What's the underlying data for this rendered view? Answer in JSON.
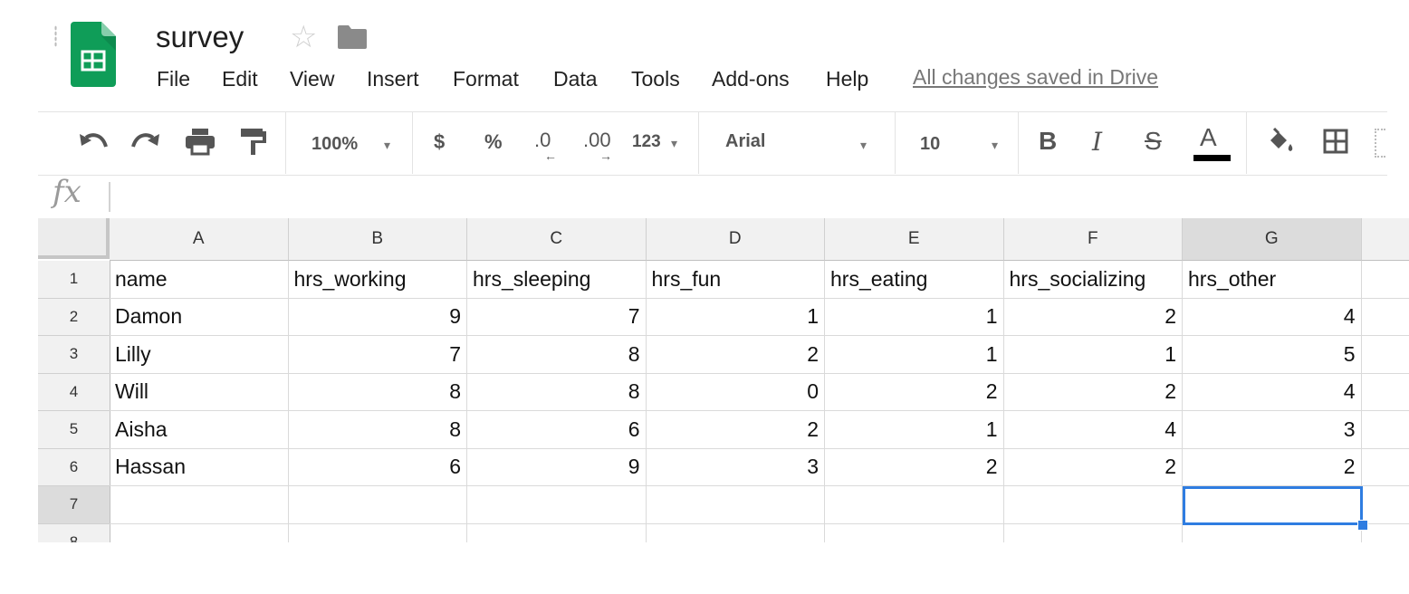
{
  "document": {
    "title": "survey"
  },
  "menu": {
    "items": [
      "File",
      "Edit",
      "View",
      "Insert",
      "Format",
      "Data",
      "Tools",
      "Add-ons",
      "Help"
    ],
    "save_status": "All changes saved in Drive"
  },
  "toolbar": {
    "zoom": "100%",
    "currency": "$",
    "percent": "%",
    "decrease_decimal": ".0",
    "increase_decimal": ".00",
    "more_formats": "123",
    "font": "Arial",
    "font_size": "10",
    "bold": "B",
    "italic": "I",
    "strikethrough": "S",
    "text_color": "A",
    "text_color_value": "#000000"
  },
  "formula_bar": {
    "label": "fx",
    "value": ""
  },
  "sheet": {
    "columns": [
      "A",
      "B",
      "C",
      "D",
      "E",
      "F",
      "G"
    ],
    "row_numbers": [
      "1",
      "2",
      "3",
      "4",
      "5",
      "6",
      "7",
      "8"
    ],
    "rows": [
      [
        "name",
        "hrs_working",
        "hrs_sleeping",
        "hrs_fun",
        "hrs_eating",
        "hrs_socializing",
        "hrs_other"
      ],
      [
        "Damon",
        "9",
        "7",
        "1",
        "1",
        "2",
        "4"
      ],
      [
        "Lilly",
        "7",
        "8",
        "2",
        "1",
        "1",
        "5"
      ],
      [
        "Will",
        "8",
        "8",
        "0",
        "2",
        "2",
        "4"
      ],
      [
        "Aisha",
        "8",
        "6",
        "2",
        "1",
        "4",
        "3"
      ],
      [
        "Hassan",
        "6",
        "9",
        "3",
        "2",
        "2",
        "2"
      ],
      [
        "",
        "",
        "",
        "",
        "",
        "",
        ""
      ],
      [
        "",
        "",
        "",
        "",
        "",
        "",
        ""
      ]
    ],
    "selected_cell": "G7",
    "selection_color": "#2f7de1"
  },
  "colors": {
    "sheets_green": "#0f9d58",
    "accent_blue": "#2f7de1"
  }
}
